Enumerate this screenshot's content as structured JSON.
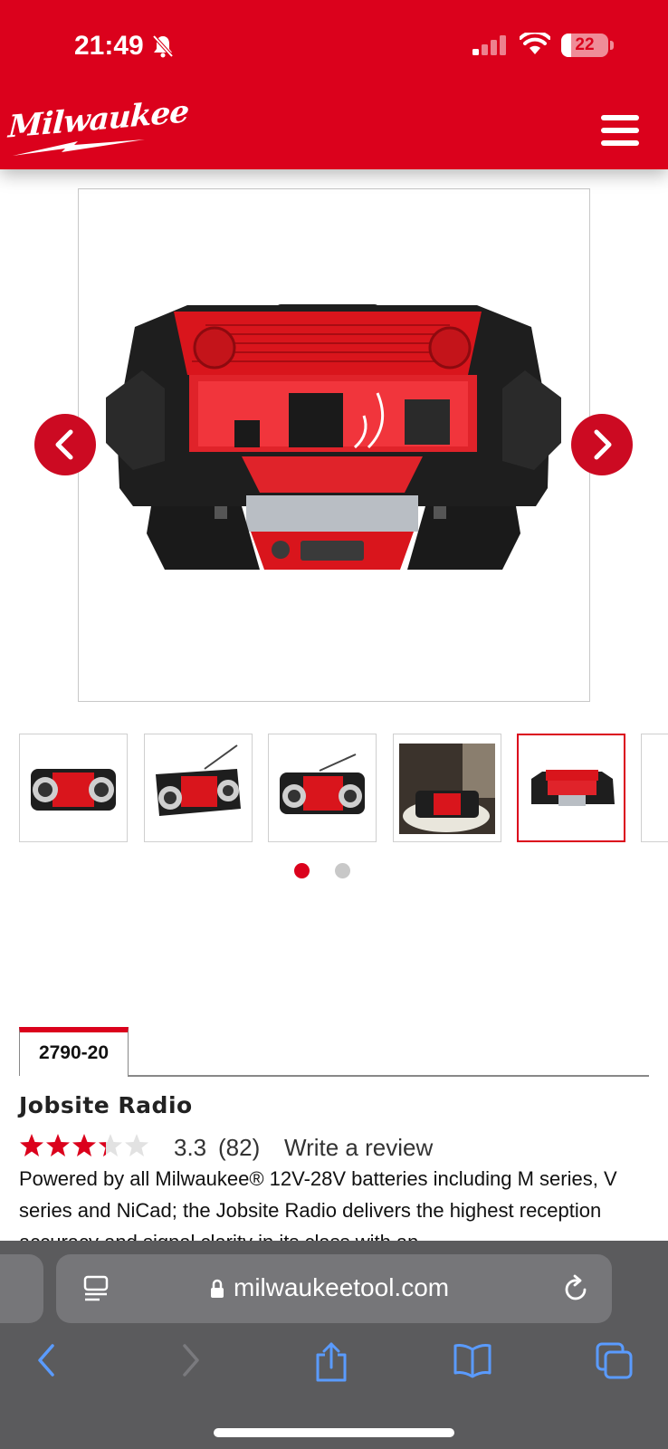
{
  "status_bar": {
    "time": "21:49",
    "battery_level": "22",
    "icons": [
      "bell-slash-icon",
      "signal-icon",
      "wifi-icon",
      "battery-icon"
    ]
  },
  "header": {
    "logo_text": "Milwaukee",
    "menu_icon": "hamburger-menu-icon",
    "colors": {
      "brand_red": "#db011c",
      "white": "#ffffff"
    }
  },
  "gallery": {
    "prev_icon": "chevron-left-icon",
    "next_icon": "chevron-right-icon",
    "thumbnail_count": 5,
    "active_thumbnail": 5,
    "page_dots": 2,
    "active_dot": 1
  },
  "product": {
    "model_tab": "2790-20",
    "title": "Jobsite Radio",
    "rating": {
      "value": "3.3",
      "count": "(82)",
      "stars_out_of_5": 3.3,
      "write_review": "Write a review"
    },
    "description": "Powered by all Milwaukee® 12V-28V batteries including M series, V series and NiCad; the Jobsite Radio delivers the highest reception accuracy and signal clarity in its class with an"
  },
  "browser": {
    "url": "milwaukeetool.com",
    "icons": [
      "page-menu-icon",
      "lock-icon",
      "reload-icon",
      "back-icon",
      "forward-icon",
      "share-icon",
      "bookmarks-icon",
      "tabs-icon"
    ]
  }
}
